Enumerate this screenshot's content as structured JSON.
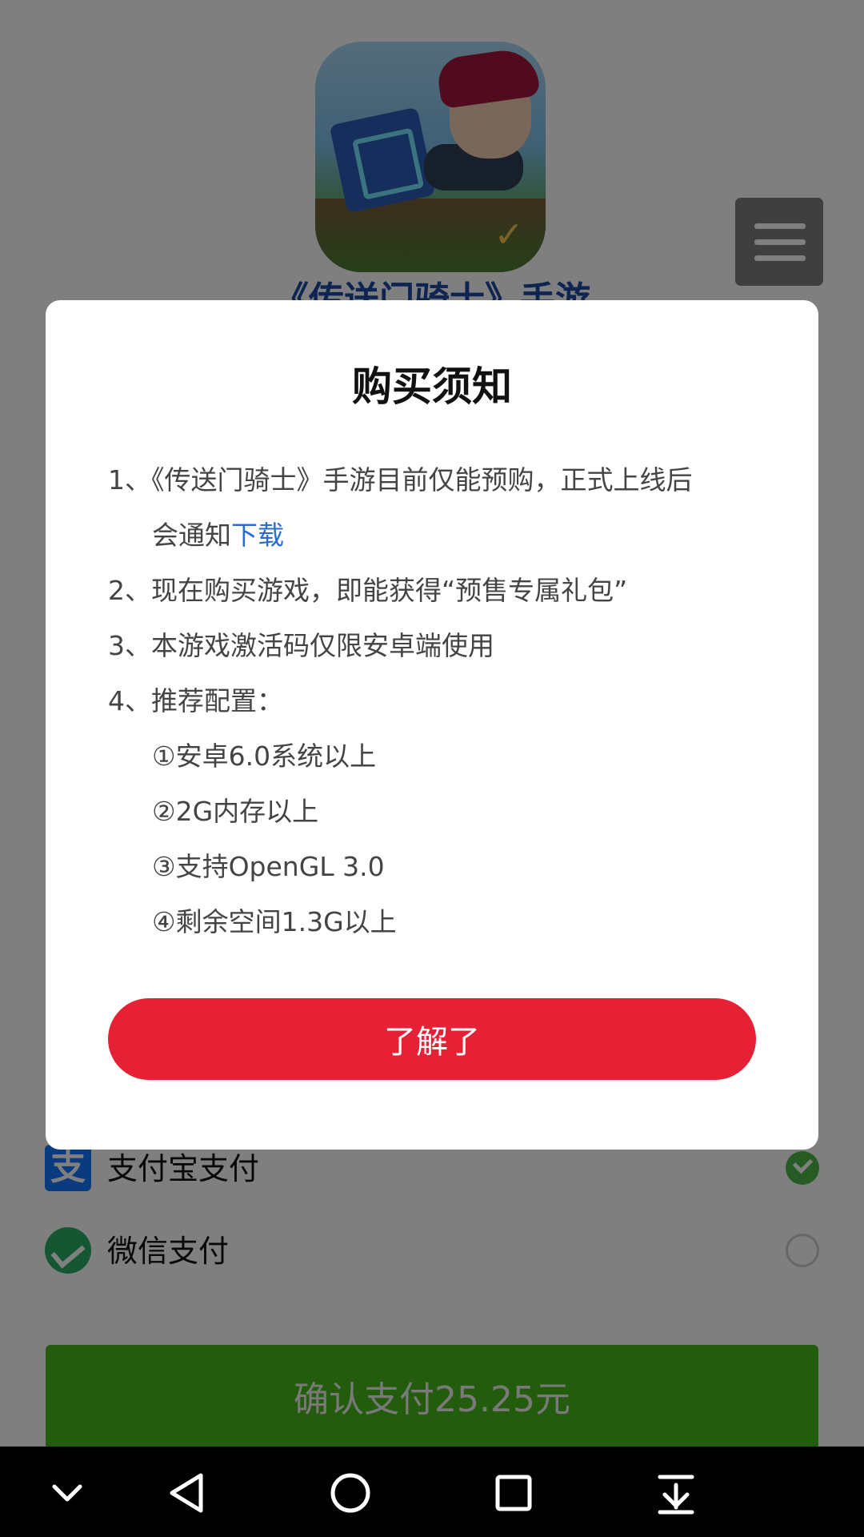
{
  "background": {
    "game_title": "《传送门骑士》手游",
    "payment": {
      "alipay_label": "支付宝支付",
      "alipay_icon": "支",
      "wechat_label": "微信支付",
      "selected": "alipay",
      "confirm_label": "确认支付25.25元"
    }
  },
  "dialog": {
    "title": "购买须知",
    "items": {
      "item1_a": "1、《传送门骑士》手游目前仅能预购，正式上线后",
      "item1_b_prefix": "会通知",
      "item1_b_link": "下载",
      "item2": "2、现在购买游戏，即能获得“预售专属礼包”",
      "item3": "3、本游戏激活码仅限安卓端使用",
      "item4": "4、推荐配置：",
      "req1": "①安卓6.0系统以上",
      "req2": "②2G内存以上",
      "req3": "③支持OpenGL 3.0",
      "req4": "④剩余空间1.3G以上"
    },
    "ok_label": "了解了"
  },
  "navbar": {
    "icons": [
      "chevron-down-icon",
      "back-icon",
      "home-icon",
      "recents-icon",
      "download-icon"
    ]
  },
  "colors": {
    "ok_button": "#e62035",
    "confirm_button": "#49b81b",
    "link": "#2b6ccc",
    "check": "#4cb948"
  }
}
